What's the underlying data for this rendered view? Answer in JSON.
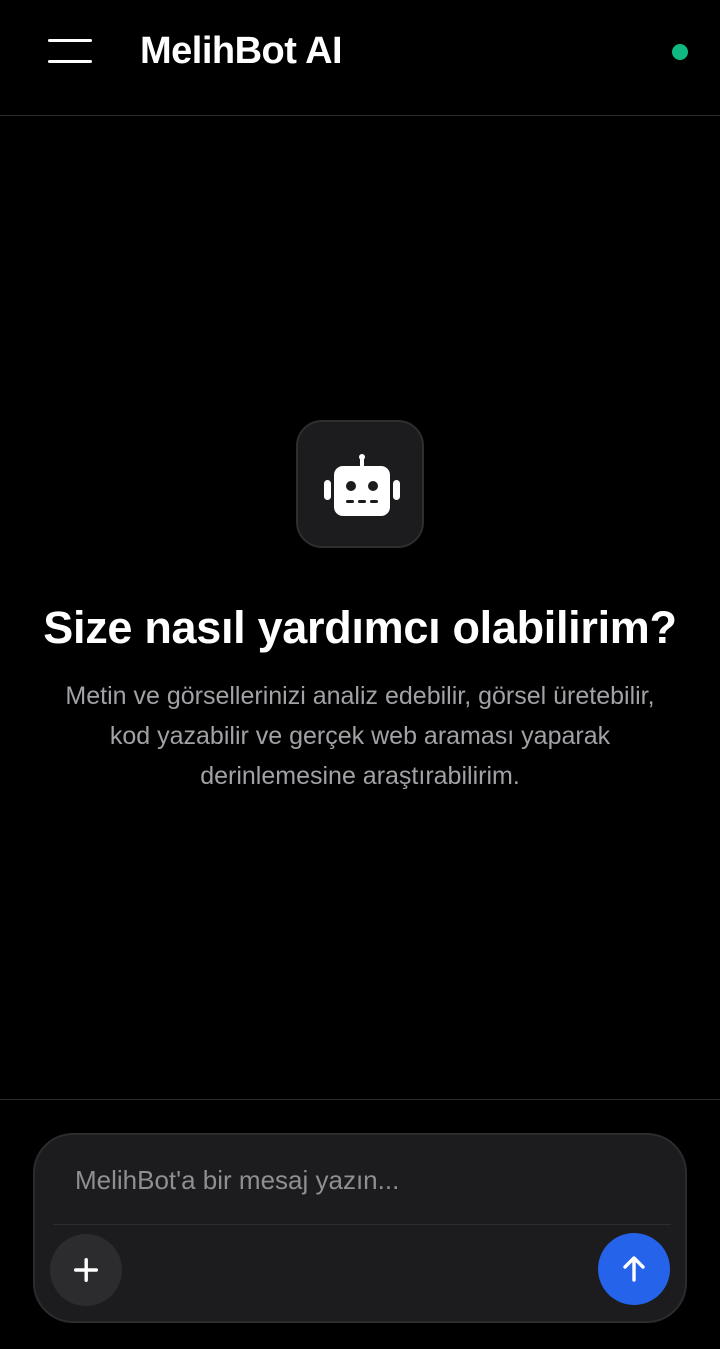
{
  "header": {
    "menu_icon": "hamburger-menu-icon",
    "title": "MelihBot AI",
    "status_color": "#10b981"
  },
  "welcome": {
    "icon": "robot-icon",
    "title": "Size nasıl yardımcı olabilirim?",
    "subtitle": "Metin ve görsellerinizi analiz edebilir, görsel üretebilir, kod yazabilir ve gerçek web araması yaparak derinlemesine araştırabilirim."
  },
  "composer": {
    "placeholder": "MelihBot'a bir mesaj yazın...",
    "value": "",
    "attach_icon": "plus-icon",
    "send_icon": "arrow-up-icon",
    "send_color": "#2563eb"
  }
}
